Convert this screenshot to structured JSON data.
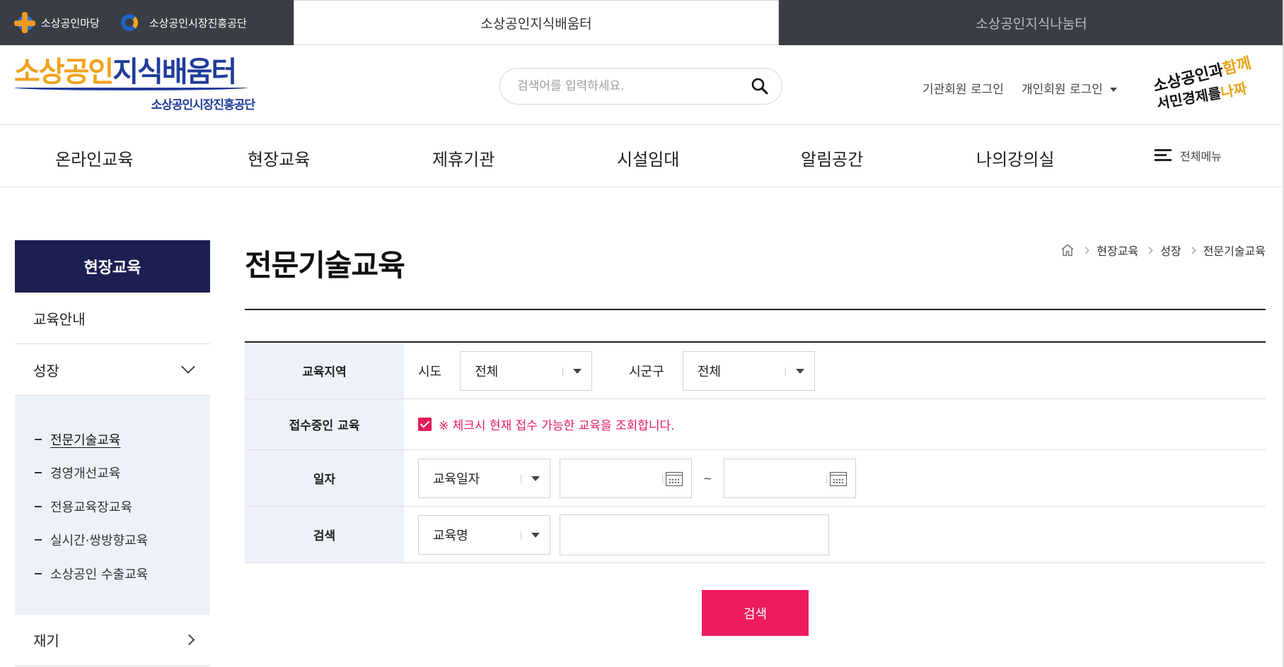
{
  "topbar": {
    "site1": "소상공인마당",
    "site2": "소상공인시장진흥공단",
    "tab_active": "소상공인지식배움터",
    "tab_inactive": "소상공인지식나눔터"
  },
  "header": {
    "brand_part1": "소상공인",
    "brand_part2": "지식배움터",
    "brand_sub": "소상공인시장진흥공단",
    "search_placeholder": "검색어를 입력하세요.",
    "login_org": "기관회원 로그인",
    "login_personal": "개인회원 로그인",
    "mascot_line1a": "소상공인과",
    "mascot_line1b": "함께",
    "mascot_line2a": "서민경제를",
    "mascot_line2b": "나짜"
  },
  "gnb": {
    "items": [
      "온라인교육",
      "현장교육",
      "제휴기관",
      "시설임대",
      "알림공간",
      "나의강의실"
    ],
    "all_menu": "전체메뉴"
  },
  "sidebar": {
    "title": "현장교육",
    "item_guide": "교육안내",
    "item_growth": "성장",
    "sub_items": [
      "전문기술교육",
      "경영개선교육",
      "전용교육장교육",
      "실시간·쌍방향교육",
      "소상공인 수출교육"
    ],
    "item_restart": "재기"
  },
  "main": {
    "page_title": "전문기술교육",
    "breadcrumb": [
      "현장교육",
      "성장",
      "전문기술교육"
    ]
  },
  "form": {
    "region_label": "교육지역",
    "sido_label": "시도",
    "sido_value": "전체",
    "sigungu_label": "시군구",
    "sigungu_value": "전체",
    "open_label": "접수중인 교육",
    "open_notice": "※ 체크시 현재 접수 가능한 교육을 조회합니다.",
    "date_label": "일자",
    "date_type_value": "교육일자",
    "date_tilde": "~",
    "search_label": "검색",
    "search_type_value": "교육명",
    "submit": "검색"
  },
  "colors": {
    "accent": "#ec1c5e",
    "sidebar_title_bg": "#1d1f52",
    "table_header_bg": "#edf2fa",
    "topbar_bg": "#3a3d44"
  }
}
